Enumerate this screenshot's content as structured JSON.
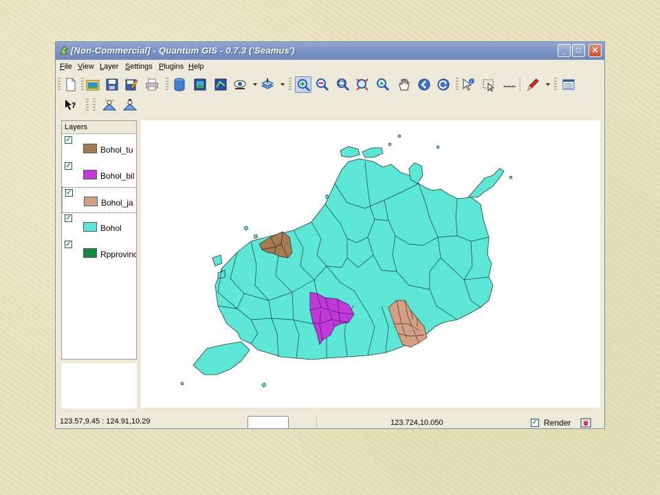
{
  "window": {
    "title": "[Non-Commercial] - Quantum GIS - 0.7.3 ('Seamus')",
    "controls": {
      "minimize": "_",
      "maximize": "□",
      "close": "✕"
    }
  },
  "menu": [
    "File",
    "View",
    "Layer",
    "Settings",
    "Plugins",
    "Help"
  ],
  "toolbar_row1": [
    "new-project-icon",
    "open-project-icon",
    "save-project-icon",
    "save-as-icon",
    "print-icon",
    "add-vector-layer-icon",
    "add-raster-layer-icon",
    "add-postgis-layer-icon",
    "show-all-layers-icon",
    "hide-all-layers-icon",
    "zoom-in-icon",
    "zoom-out-icon",
    "zoom-full-icon",
    "zoom-to-selection-icon",
    "zoom-to-layer-icon",
    "pan-icon",
    "zoom-last-icon",
    "refresh-icon",
    "identify-icon",
    "select-icon",
    "measure-icon",
    "capture-icon",
    "attribute-table-icon"
  ],
  "toolbar_row2": [
    "whats-this-icon",
    "gps-icon",
    "georeferencer-icon"
  ],
  "layers_panel": {
    "header": "Layers",
    "layers": [
      {
        "name": "Bohol_tu",
        "checked": true,
        "color": "#a57b52"
      },
      {
        "name": "Bohol_bil",
        "checked": true,
        "color": "#c13ad8"
      },
      {
        "name": "Bohol_ja",
        "checked": true,
        "color": "#d4a085",
        "selected": true
      },
      {
        "name": "Bohol",
        "checked": true,
        "color": "#5ce6d6"
      },
      {
        "name": "Rpprovinc",
        "checked": true,
        "color": "#0e8a3c"
      }
    ]
  },
  "map": {
    "island_color": "#5ce6d6",
    "highlight_colors": {
      "tu": "#a57b52",
      "bil": "#c13ad8",
      "ja": "#d4a085"
    }
  },
  "status": {
    "extent": "123.57,9.45 : 124.91,10.29",
    "coordinate": "123.724,10.050",
    "render_label": "Render",
    "render_checked": true
  }
}
